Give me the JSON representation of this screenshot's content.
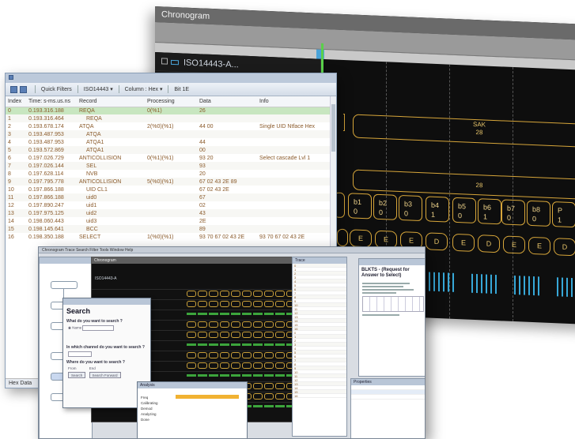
{
  "chronogram": {
    "title": "Chronogram",
    "channel": "ISO14443-A...",
    "sak_label": "SAK",
    "sak_value": "28",
    "bus_value": "28",
    "bits": [
      {
        "name": "b1",
        "value": "0"
      },
      {
        "name": "b2",
        "value": "0"
      },
      {
        "name": "b3",
        "value": "0"
      },
      {
        "name": "b4",
        "value": "1"
      },
      {
        "name": "b5",
        "value": "0"
      },
      {
        "name": "b6",
        "value": "1"
      },
      {
        "name": "b7",
        "value": "0"
      },
      {
        "name": "b8",
        "value": "0"
      },
      {
        "name": "P",
        "value": "1"
      }
    ],
    "pulse_codes": [
      "E",
      "E",
      "E",
      "D",
      "E",
      "D",
      "E",
      "E",
      "D"
    ]
  },
  "trace": {
    "toolbar": {
      "quick_filters": "Quick Filters",
      "protocol": "ISO14443",
      "columns": "Column : Hex",
      "bits": "Bit 1E"
    },
    "columns": [
      "Index",
      "Time: s-ms.us.ns",
      "Record",
      "Processing",
      "Data",
      "Info"
    ],
    "rows": [
      {
        "index": "0",
        "time": "0.193.316.188",
        "record": "REQA",
        "processing": "0(%1)",
        "data": "26",
        "info": ""
      },
      {
        "index": "1",
        "time": "0.193.316.464",
        "record": "REQA",
        "processing": "",
        "data": "",
        "info": ""
      },
      {
        "index": "2",
        "time": "0.193.678.174",
        "record": "ATQA",
        "processing": "2(%0)(%1)",
        "data": "44 00",
        "info": "Single UID Ntface Hex"
      },
      {
        "index": "3",
        "time": "0.193.487.953",
        "record": "ATQA",
        "processing": "",
        "data": "",
        "info": ""
      },
      {
        "index": "4",
        "time": "0.193.487.953",
        "record": "ATQA1",
        "processing": "",
        "data": "44",
        "info": ""
      },
      {
        "index": "5",
        "time": "0.193.572.869",
        "record": "ATQA1",
        "processing": "",
        "data": "00",
        "info": ""
      },
      {
        "index": "6",
        "time": "0.197.026.729",
        "record": "ANTICOLLISION",
        "processing": "0(%1)(%1)",
        "data": "93 20",
        "info": "Select cascade Lvl 1"
      },
      {
        "index": "7",
        "time": "0.197.026.144",
        "record": "SEL",
        "processing": "",
        "data": "93",
        "info": ""
      },
      {
        "index": "8",
        "time": "0.197.628.114",
        "record": "NVB",
        "processing": "",
        "data": "20",
        "info": ""
      },
      {
        "index": "9",
        "time": "0.197.795.778",
        "record": "ANTICOLLISION",
        "processing": "5(%0)(%1)",
        "data": "67 02 43 2E 89",
        "info": ""
      },
      {
        "index": "10",
        "time": "0.197.866.188",
        "record": "UID CL1",
        "processing": "",
        "data": "67 02 43 2E",
        "info": ""
      },
      {
        "index": "11",
        "time": "0.197.866.188",
        "record": "uid0",
        "processing": "",
        "data": "67",
        "info": ""
      },
      {
        "index": "12",
        "time": "0.197.890.247",
        "record": "uid1",
        "processing": "",
        "data": "02",
        "info": ""
      },
      {
        "index": "13",
        "time": "0.197.975.125",
        "record": "uid2",
        "processing": "",
        "data": "43",
        "info": ""
      },
      {
        "index": "14",
        "time": "0.198.060.443",
        "record": "uid3",
        "processing": "",
        "data": "2E",
        "info": ""
      },
      {
        "index": "15",
        "time": "0.198.145.641",
        "record": "BCC",
        "processing": "",
        "data": "89",
        "info": ""
      },
      {
        "index": "16",
        "time": "0.198.350.188",
        "record": "SELECT",
        "processing": "1(%0)(%1)",
        "data": "93 70 67 02 43 2E",
        "info": "93 70 67 02 43 2E"
      }
    ],
    "status": "Hex Data"
  },
  "front": {
    "menu": "Chronogram  Trace  Search  Filter  Tools  Window  Help",
    "mini_chrono_title": "Chronogram",
    "mini_channel": "ISO14443-A",
    "mini_trace_title": "Trace",
    "doc_title": "BLKTS - (Request for Answer to Select)",
    "props_title": "Properties",
    "search": {
      "title": "Search",
      "q1": "What do you want to search ?",
      "opt_name": "Name",
      "q2": "In which channel do you want to search ?",
      "q3": "Where do you want to search ?",
      "from": "From",
      "to": "End",
      "btn_search": "Search",
      "btn_next": "Search Forward"
    },
    "progress_title": "Analysis",
    "progress_rows": [
      "Freq",
      "Calibrating",
      "Demod",
      "Analyzing",
      "Done"
    ]
  }
}
